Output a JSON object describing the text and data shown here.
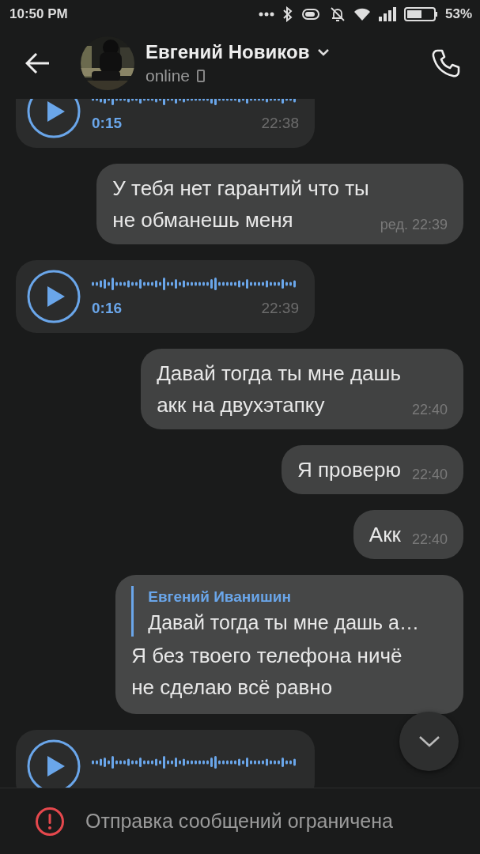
{
  "status_bar": {
    "time": "10:50 PM",
    "battery": "53%"
  },
  "header": {
    "name": "Евгений Новиков",
    "status": "online"
  },
  "messages": [
    {
      "kind": "voice",
      "outgoing": false,
      "duration": "0:15",
      "time": "22:38"
    },
    {
      "kind": "text",
      "outgoing": true,
      "text": "У тебя нет гарантий что ты\nне обманешь меня",
      "edited": "ред.",
      "time": "22:39"
    },
    {
      "kind": "voice",
      "outgoing": false,
      "duration": "0:16",
      "time": "22:39"
    },
    {
      "kind": "text",
      "outgoing": true,
      "text": "Давай тогда ты мне дашь\nакк на двухэтапку",
      "time": "22:40"
    },
    {
      "kind": "text",
      "outgoing": true,
      "text": "Я проверю",
      "time": "22:40"
    },
    {
      "kind": "text",
      "outgoing": true,
      "text": "Акк",
      "time": "22:40"
    },
    {
      "kind": "reply",
      "outgoing": true,
      "reply_author": "Евгений Иванишин",
      "reply_text": "Давай тогда ты мне дашь а…",
      "text": "Я без твоего телефона ничё\nне сделаю всё равно"
    },
    {
      "kind": "voice",
      "outgoing": false
    }
  ],
  "footer": {
    "notice": "Отправка сообщений ограничена"
  }
}
